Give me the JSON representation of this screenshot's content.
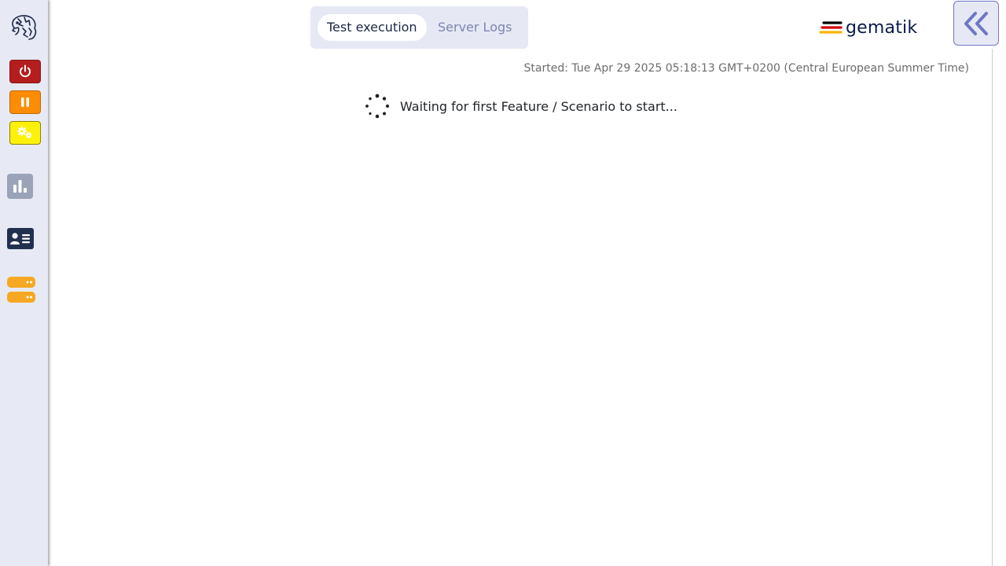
{
  "sidebar": {
    "logo_icon": "lion-logo-icon",
    "controls": [
      {
        "name": "quit",
        "icon": "power-icon",
        "color": "#b51e1e"
      },
      {
        "name": "pause",
        "icon": "pause-icon",
        "color": "#fc8c03"
      },
      {
        "name": "settings",
        "icon": "gears-icon",
        "color": "#fdf10a"
      }
    ],
    "nav": [
      {
        "name": "statistics",
        "icon": "bar-chart-icon"
      },
      {
        "name": "contact",
        "icon": "id-card-icon"
      },
      {
        "name": "servers",
        "icon": "server-icon"
      }
    ]
  },
  "tabs": [
    {
      "label": "Test execution",
      "active": true
    },
    {
      "label": "Server Logs",
      "active": false
    }
  ],
  "brand": {
    "name": "gematik",
    "colors": [
      "#000000",
      "#d40000",
      "#f7b500"
    ]
  },
  "collapse_icon": "double-chevron-left-icon",
  "started_text": "Started: Tue Apr 29 2025 05:18:13 GMT+0200 (Central European Summer Time)",
  "status_text": "Waiting for first Feature / Scenario to start..."
}
